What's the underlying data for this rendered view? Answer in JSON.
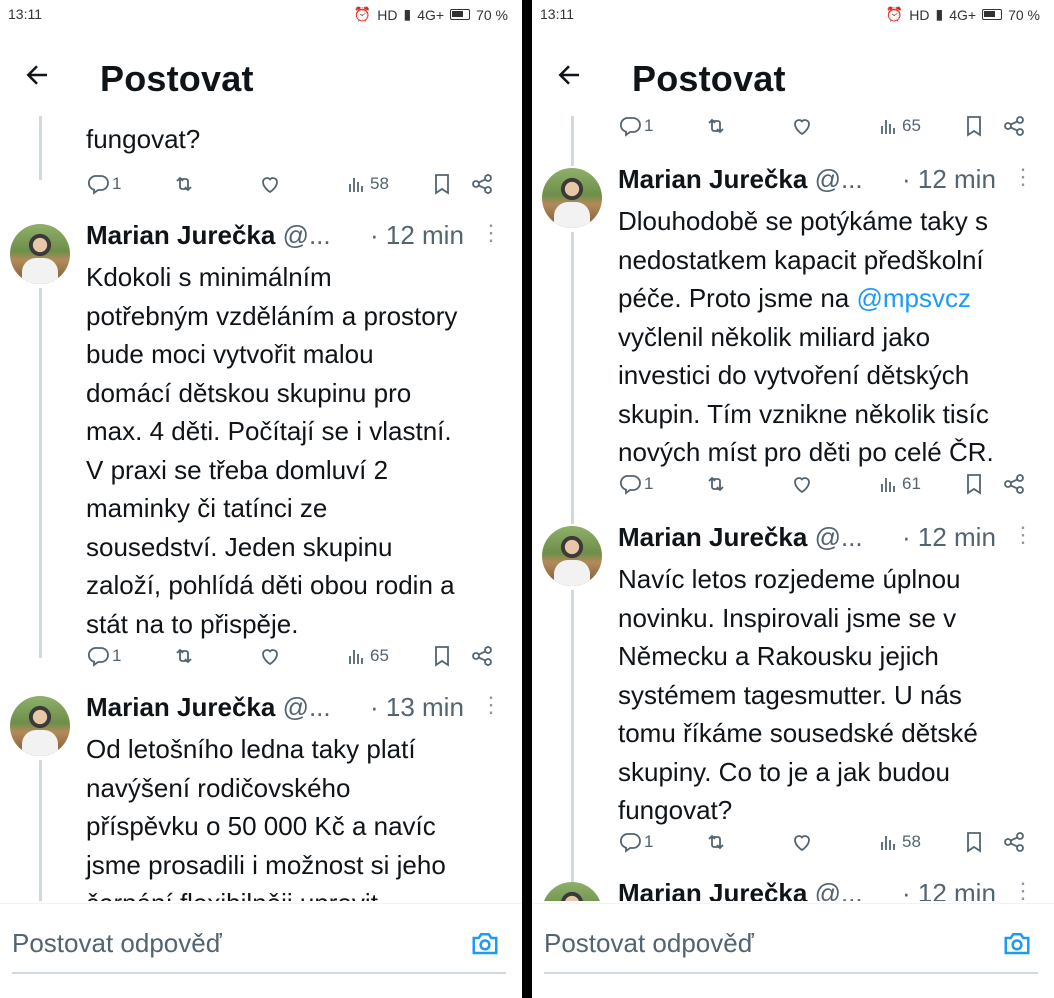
{
  "status": {
    "time": "13:11",
    "indicators": "HD",
    "network": "4G+",
    "battery": "70 %"
  },
  "header": {
    "title": "Postovat"
  },
  "reply": {
    "placeholder": "Postovat odpověď"
  },
  "left": {
    "top_fragment": "fungovat?",
    "top_actions": {
      "replies": "1",
      "views": "58"
    },
    "tweets": [
      {
        "name": "Marian Jurečka",
        "handle": "@...",
        "time": "· 12 min",
        "lines": [
          "Kdokoli s minimálním",
          "potřebným vzděláním a prostory",
          "bude moci vytvořit malou",
          "domácí dětskou skupinu pro",
          "max. 4 děti. Počítají se i vlastní.",
          "V praxi se třeba domluví 2",
          "maminky či tatínci ze",
          "sousedství. Jeden skupinu",
          "založí, pohlídá děti obou rodin a",
          "stát na to přispěje."
        ],
        "replies": "1",
        "views": "65"
      },
      {
        "name": "Marian Jurečka",
        "handle": "@...",
        "time": "· 13 min",
        "lines": [
          "Od letošního ledna taky platí",
          "navýšení rodičovského",
          "příspěvku o 50 000 Kč a navíc",
          "jsme prosadili i možnost si jeho",
          "čerpání flexibilněji upravit"
        ]
      }
    ]
  },
  "right": {
    "top_actions": {
      "replies": "1",
      "views": "65"
    },
    "tweets": [
      {
        "name": "Marian Jurečka",
        "handle": "@...",
        "time": "· 12 min",
        "lines": [
          "Dlouhodobě se potýkáme taky s",
          "nedostatkem kapacit předškolní",
          "péče. Proto jsme na ",
          "vyčlenil několik miliard jako",
          "investici do vytvoření dětských",
          "skupin. Tím vznikne několik tisíc",
          "nových míst pro děti po celé ČR."
        ],
        "mention": "@mpsvcz",
        "replies": "1",
        "views": "61"
      },
      {
        "name": "Marian Jurečka",
        "handle": "@...",
        "time": "· 12 min",
        "lines": [
          "Navíc letos rozjedeme úplnou",
          "novinku. Inspirovali jsme se v",
          "Německu a Rakousku jejich",
          "systémem tagesmutter. U nás",
          "tomu říkáme sousedské dětské",
          "skupiny. Co to je a jak budou",
          "fungovat?"
        ],
        "replies": "1",
        "views": "58"
      },
      {
        "name": "Marian Jurečka",
        "handle": "@...",
        "time": "· 12 min"
      }
    ]
  }
}
